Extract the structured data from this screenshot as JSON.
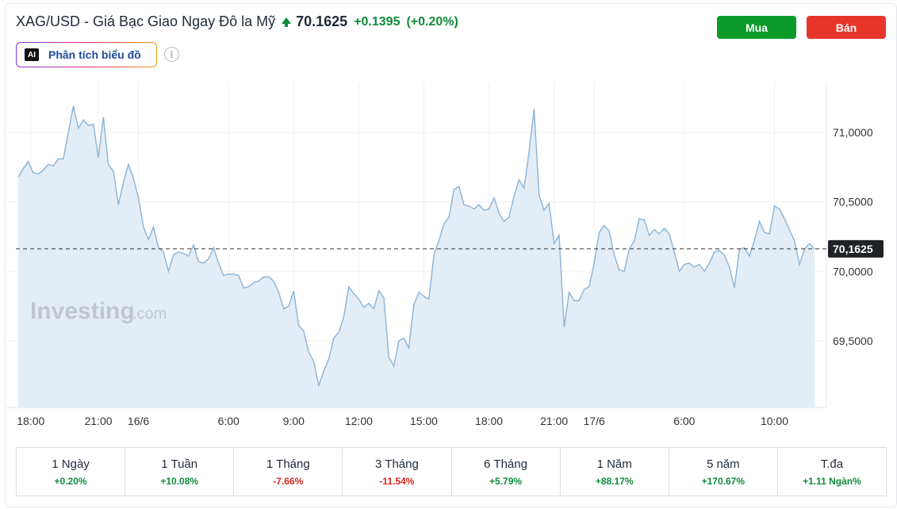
{
  "header": {
    "title": "XAG/USD - Giá Bạc Giao Ngay Đô la Mỹ",
    "price": "70.1625",
    "change": "+0.1395",
    "change_pct": "(+0.20%)"
  },
  "ai_button": {
    "icon_text": "AI",
    "label": "Phân tích biểu đồ"
  },
  "info_icon": "i",
  "actions": {
    "buy_label": "Mua",
    "sell_label": "Bán"
  },
  "colors": {
    "up": "#0e8a3a",
    "down": "#d8261c",
    "buy": "#0c9b2a",
    "sell": "#e8352a",
    "line": "#8fb7d8",
    "area": "#e3edf6"
  },
  "watermark": {
    "brand": "Investing",
    "suffix": ".com"
  },
  "chart_data": {
    "type": "area",
    "x_ticks": [
      {
        "label": "18:00",
        "i": 2.5
      },
      {
        "label": "21:00",
        "i": 16
      },
      {
        "label": "16/6",
        "i": 24
      },
      {
        "label": "6:00",
        "i": 42
      },
      {
        "label": "9:00",
        "i": 55
      },
      {
        "label": "12:00",
        "i": 68
      },
      {
        "label": "15:00",
        "i": 81
      },
      {
        "label": "18:00",
        "i": 94
      },
      {
        "label": "21:00",
        "i": 107
      },
      {
        "label": "17/6",
        "i": 115
      },
      {
        "label": "6:00",
        "i": 133
      },
      {
        "label": "10:00",
        "i": 151
      }
    ],
    "y_ticks": [
      71.0,
      70.5,
      70.0,
      69.5
    ],
    "y_tick_labels": [
      "71,0000",
      "70,5000",
      "70,0000",
      "69,5000"
    ],
    "ylim": [
      69.02,
      71.36
    ],
    "last_value": 70.1625,
    "last_label": "70,1625",
    "grid": true,
    "values": [
      70.68,
      70.74,
      70.79,
      70.71,
      70.7,
      70.73,
      70.77,
      70.76,
      70.81,
      70.81,
      71.0,
      71.19,
      71.03,
      71.09,
      71.05,
      71.06,
      70.82,
      71.11,
      70.77,
      70.72,
      70.48,
      70.64,
      70.77,
      70.67,
      70.53,
      70.32,
      70.23,
      70.32,
      70.17,
      70.14,
      70.0,
      70.12,
      70.14,
      70.13,
      70.11,
      70.19,
      70.07,
      70.06,
      70.09,
      70.17,
      70.06,
      69.97,
      69.98,
      69.98,
      69.97,
      69.88,
      69.89,
      69.92,
      69.93,
      69.96,
      69.96,
      69.93,
      69.85,
      69.73,
      69.75,
      69.86,
      69.61,
      69.57,
      69.42,
      69.35,
      69.18,
      69.28,
      69.37,
      69.52,
      69.56,
      69.67,
      69.89,
      69.84,
      69.8,
      69.74,
      69.77,
      69.73,
      69.86,
      69.81,
      69.38,
      69.32,
      69.5,
      69.52,
      69.45,
      69.76,
      69.85,
      69.82,
      69.8,
      70.12,
      70.22,
      70.34,
      70.39,
      70.59,
      70.61,
      70.48,
      70.47,
      70.45,
      70.48,
      70.44,
      70.45,
      70.53,
      70.42,
      70.36,
      70.39,
      70.54,
      70.66,
      70.6,
      70.86,
      71.17,
      70.55,
      70.44,
      70.49,
      70.2,
      70.26,
      69.6,
      69.85,
      69.79,
      69.79,
      69.87,
      69.89,
      70.06,
      70.28,
      70.33,
      70.29,
      70.12,
      70.01,
      70.0,
      70.16,
      70.22,
      70.38,
      70.37,
      70.26,
      70.3,
      70.27,
      70.31,
      70.27,
      70.14,
      70.0,
      70.05,
      70.06,
      70.03,
      70.05,
      70.0,
      70.06,
      70.14,
      70.15,
      70.12,
      70.03,
      69.88,
      70.16,
      70.17,
      70.11,
      70.22,
      70.36,
      70.28,
      70.27,
      70.47,
      70.45,
      70.38,
      70.3,
      70.22,
      70.05,
      70.16,
      70.2,
      70.16
    ]
  },
  "performance": [
    {
      "label": "1 Ngày",
      "value": "+0.20%",
      "dir": "up"
    },
    {
      "label": "1 Tuần",
      "value": "+10.08%",
      "dir": "up"
    },
    {
      "label": "1 Tháng",
      "value": "-7.66%",
      "dir": "down"
    },
    {
      "label": "3 Tháng",
      "value": "-11.54%",
      "dir": "down"
    },
    {
      "label": "6 Tháng",
      "value": "+5.79%",
      "dir": "up"
    },
    {
      "label": "1 Năm",
      "value": "+88.17%",
      "dir": "up"
    },
    {
      "label": "5 năm",
      "value": "+170.67%",
      "dir": "up"
    },
    {
      "label": "T.đa",
      "value": "+1.11 Ngàn%",
      "dir": "up"
    }
  ]
}
